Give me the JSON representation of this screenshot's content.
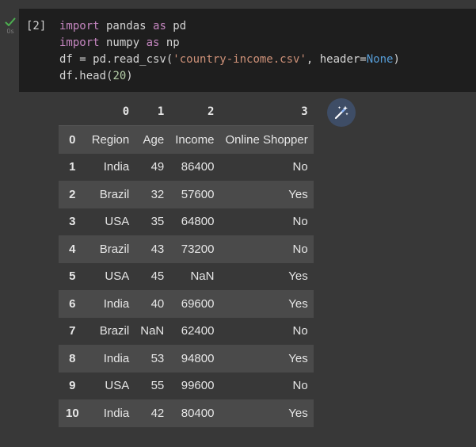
{
  "cell": {
    "status_icon": "check-icon",
    "exec_time": "0s",
    "exec_count": "[2]",
    "code_lines": [
      [
        {
          "t": "import",
          "c": "kw"
        },
        {
          "t": " pandas ",
          "c": "plain"
        },
        {
          "t": "as",
          "c": "kw"
        },
        {
          "t": " pd",
          "c": "plain"
        }
      ],
      [
        {
          "t": "import",
          "c": "kw"
        },
        {
          "t": " numpy ",
          "c": "plain"
        },
        {
          "t": "as",
          "c": "kw"
        },
        {
          "t": " np",
          "c": "plain"
        }
      ],
      [
        {
          "t": "df = pd.read_csv(",
          "c": "plain"
        },
        {
          "t": "'country-income.csv'",
          "c": "str"
        },
        {
          "t": ", header=",
          "c": "plain"
        },
        {
          "t": "None",
          "c": "const"
        },
        {
          "t": ")",
          "c": "plain"
        }
      ],
      [
        {
          "t": "df.head(",
          "c": "plain"
        },
        {
          "t": "20",
          "c": "num"
        },
        {
          "t": ")",
          "c": "plain"
        }
      ]
    ]
  },
  "output": {
    "magic_icon": "magic-wand-icon",
    "columns": [
      "",
      "0",
      "1",
      "2",
      "3"
    ],
    "rows": [
      {
        "idx": "0",
        "cells": [
          "Region",
          "Age",
          "Income",
          "Online Shopper"
        ]
      },
      {
        "idx": "1",
        "cells": [
          "India",
          "49",
          "86400",
          "No"
        ]
      },
      {
        "idx": "2",
        "cells": [
          "Brazil",
          "32",
          "57600",
          "Yes"
        ]
      },
      {
        "idx": "3",
        "cells": [
          "USA",
          "35",
          "64800",
          "No"
        ]
      },
      {
        "idx": "4",
        "cells": [
          "Brazil",
          "43",
          "73200",
          "No"
        ]
      },
      {
        "idx": "5",
        "cells": [
          "USA",
          "45",
          "NaN",
          "Yes"
        ]
      },
      {
        "idx": "6",
        "cells": [
          "India",
          "40",
          "69600",
          "Yes"
        ]
      },
      {
        "idx": "7",
        "cells": [
          "Brazil",
          "NaN",
          "62400",
          "No"
        ]
      },
      {
        "idx": "8",
        "cells": [
          "India",
          "53",
          "94800",
          "Yes"
        ]
      },
      {
        "idx": "9",
        "cells": [
          "USA",
          "55",
          "99600",
          "No"
        ]
      },
      {
        "idx": "10",
        "cells": [
          "India",
          "42",
          "80400",
          "Yes"
        ]
      }
    ]
  },
  "colors": {
    "page_bg": "#383838",
    "code_bg": "#1e1e1e",
    "stripe_bg": "#4a4a4a",
    "success_green": "#4caf50",
    "keyword": "#c586c0",
    "string": "#ce9178",
    "number": "#b5cea8",
    "constant": "#569cd6"
  }
}
